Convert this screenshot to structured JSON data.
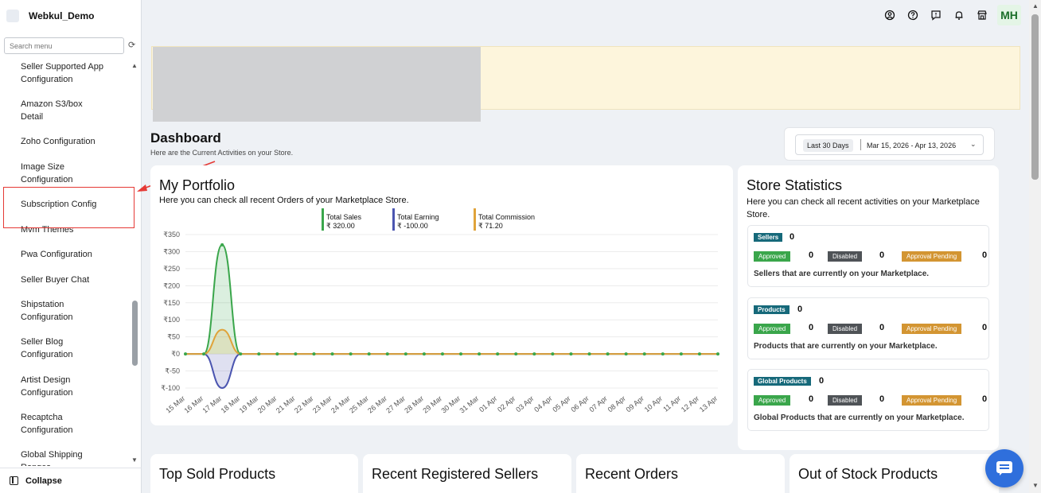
{
  "sidebar": {
    "brand": "Webkul_Demo",
    "search_placeholder": "Search menu",
    "items": [
      {
        "label": "Seller Supported App Configuration"
      },
      {
        "label": "Amazon S3/box Detail"
      },
      {
        "label": "Zoho Configuration"
      },
      {
        "label": "Image Size Configuration"
      },
      {
        "label": "Subscription Config"
      },
      {
        "label": "Mvm Themes"
      },
      {
        "label": "Pwa Configuration"
      },
      {
        "label": "Seller Buyer Chat"
      },
      {
        "label": "Shipstation Configuration"
      },
      {
        "label": "Seller Blog Configuration"
      },
      {
        "label": "Artist Design Configuration"
      },
      {
        "label": "Recaptcha Configuration"
      },
      {
        "label": "Global Shipping Ranges"
      }
    ],
    "collapse_label": "Collapse"
  },
  "topbar": {
    "icons": [
      "user-circle-icon",
      "help-icon",
      "feedback-icon",
      "bell-icon",
      "store-icon"
    ],
    "avatar_initials": "MH"
  },
  "dashboard": {
    "title": "Dashboard",
    "subtitle": "Here are the Current Activities on your Store.",
    "date_preset": "Last 30 Days",
    "date_range": "Mar 15, 2026 - Apr 13, 2026"
  },
  "portfolio": {
    "title": "My Portfolio",
    "subtitle": "Here you can check all recent Orders of your Marketplace Store.",
    "legend": [
      {
        "label": "Total Sales",
        "value": "₹ 320.00",
        "color": "#3aa64b"
      },
      {
        "label": "Total Earning",
        "value": "₹ -100.00",
        "color": "#4b55b0"
      },
      {
        "label": "Total Commission",
        "value": "₹ 71.20",
        "color": "#e0a33a"
      }
    ]
  },
  "chart_data": {
    "type": "line",
    "title": "",
    "xlabel": "",
    "ylabel": "",
    "ylim": [
      -100,
      350
    ],
    "yticks": [
      "₹350",
      "₹300",
      "₹250",
      "₹200",
      "₹150",
      "₹100",
      "₹50",
      "₹0",
      "₹-50",
      "₹-100"
    ],
    "categories": [
      "15 Mar",
      "16 Mar",
      "17 Mar",
      "18 Mar",
      "19 Mar",
      "20 Mar",
      "21 Mar",
      "22 Mar",
      "23 Mar",
      "24 Mar",
      "25 Mar",
      "26 Mar",
      "27 Mar",
      "28 Mar",
      "29 Mar",
      "30 Mar",
      "31 Mar",
      "01 Apr",
      "02 Apr",
      "03 Apr",
      "04 Apr",
      "05 Apr",
      "06 Apr",
      "07 Apr",
      "08 Apr",
      "09 Apr",
      "10 Apr",
      "11 Apr",
      "12 Apr",
      "13 Apr"
    ],
    "series": [
      {
        "name": "Total Sales",
        "color": "#3aa64b",
        "values": [
          0,
          0,
          320,
          0,
          0,
          0,
          0,
          0,
          0,
          0,
          0,
          0,
          0,
          0,
          0,
          0,
          0,
          0,
          0,
          0,
          0,
          0,
          0,
          0,
          0,
          0,
          0,
          0,
          0,
          0
        ]
      },
      {
        "name": "Total Earning",
        "color": "#4b55b0",
        "values": [
          0,
          0,
          -100,
          0,
          0,
          0,
          0,
          0,
          0,
          0,
          0,
          0,
          0,
          0,
          0,
          0,
          0,
          0,
          0,
          0,
          0,
          0,
          0,
          0,
          0,
          0,
          0,
          0,
          0,
          0
        ]
      },
      {
        "name": "Total Commission",
        "color": "#e0a33a",
        "values": [
          0,
          0,
          71.2,
          0,
          0,
          0,
          0,
          0,
          0,
          0,
          0,
          0,
          0,
          0,
          0,
          0,
          0,
          0,
          0,
          0,
          0,
          0,
          0,
          0,
          0,
          0,
          0,
          0,
          0,
          0
        ]
      }
    ],
    "grid": true
  },
  "stats": {
    "title": "Store Statistics",
    "subtitle": "Here you can check all recent activities on your Marketplace Store.",
    "boxes": [
      {
        "heading": "Sellers",
        "count": "0",
        "approved_label": "Approved",
        "approved": "0",
        "disabled_label": "Disabled",
        "disabled": "0",
        "pending_label": "Approval Pending",
        "pending": "0",
        "desc": "Sellers that are currently on your Marketplace."
      },
      {
        "heading": "Products",
        "count": "0",
        "approved_label": "Approved",
        "approved": "0",
        "disabled_label": "Disabled",
        "disabled": "0",
        "pending_label": "Approval Pending",
        "pending": "0",
        "desc": "Products that are currently on your Marketplace."
      },
      {
        "heading": "Global Products",
        "count": "0",
        "approved_label": "Approved",
        "approved": "0",
        "disabled_label": "Disabled",
        "disabled": "0",
        "pending_label": "Approval Pending",
        "pending": "0",
        "desc": "Global Products that are currently on your Marketplace."
      }
    ]
  },
  "bottom_cards": [
    "Top Sold Products",
    "Recent Registered Sellers",
    "Recent Orders",
    "Out of Stock Products"
  ]
}
